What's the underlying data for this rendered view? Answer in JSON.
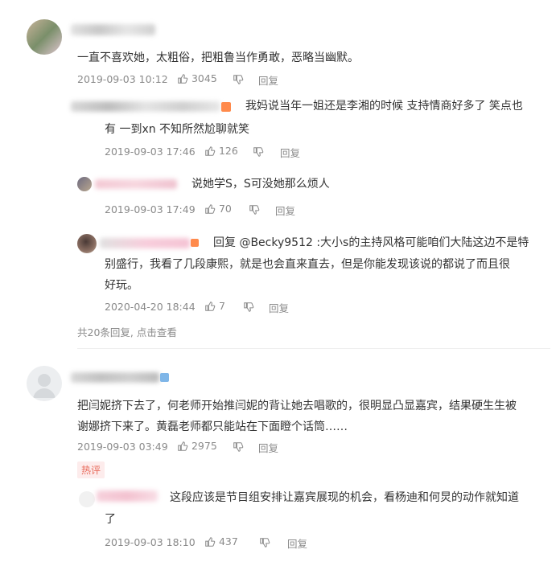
{
  "comments": [
    {
      "text": [
        "一直不喜欢她，太粗俗，把粗鲁当作勇敢，恶略当幽默。"
      ],
      "time": "2019-09-03 10:12",
      "likes": "3045",
      "reply": "回复",
      "replies": [
        {
          "text": [
            "我妈说当年一姐还是李湘的时候 支持情商好多了  笑点也",
            "有  一到xn 不知所然尬聊就笑"
          ],
          "time": "2019-09-03 17:46",
          "likes": "126",
          "reply": "回复"
        },
        {
          "text": [
            "说她学S，S可没她那么烦人"
          ],
          "time": "2019-09-03 17:49",
          "likes": "70",
          "reply": "回复"
        },
        {
          "text": [
            "回复 @Becky9512 :大小s的主持风格可能咱们大陆这边不是特",
            "别盛行，我看了几段康熙，就是也会直来直去，但是你能发现该说的都说了而且很",
            "好玩。"
          ],
          "time": "2020-04-20 18:44",
          "likes": "7",
          "reply": "回复"
        }
      ],
      "more": "共20条回复, 点击查看"
    },
    {
      "text": [
        "把闫妮挤下去了，何老师开始推闫妮的背让她去唱歌的，很明显凸显嘉宾，结果硬生生被",
        "谢娜挤下来了。黄磊老师都只能站在下面瞪个话筒……"
      ],
      "time": "2019-09-03 03:49",
      "likes": "2975",
      "reply": "回复",
      "badge": "热评",
      "replies": [
        {
          "text": [
            "这段应该是节目组安排让嘉宾展现的机会，看杨迪和何炅的动作就知道",
            "了"
          ],
          "time": "2019-09-03 18:10",
          "likes": "437",
          "reply": "回复"
        }
      ]
    }
  ],
  "colors": {
    "text": "#333333",
    "meta": "#8a8a8a",
    "badge_bg": "#fdecec",
    "badge_text": "#e86a5a",
    "level_badge": "#ff8a4c"
  }
}
